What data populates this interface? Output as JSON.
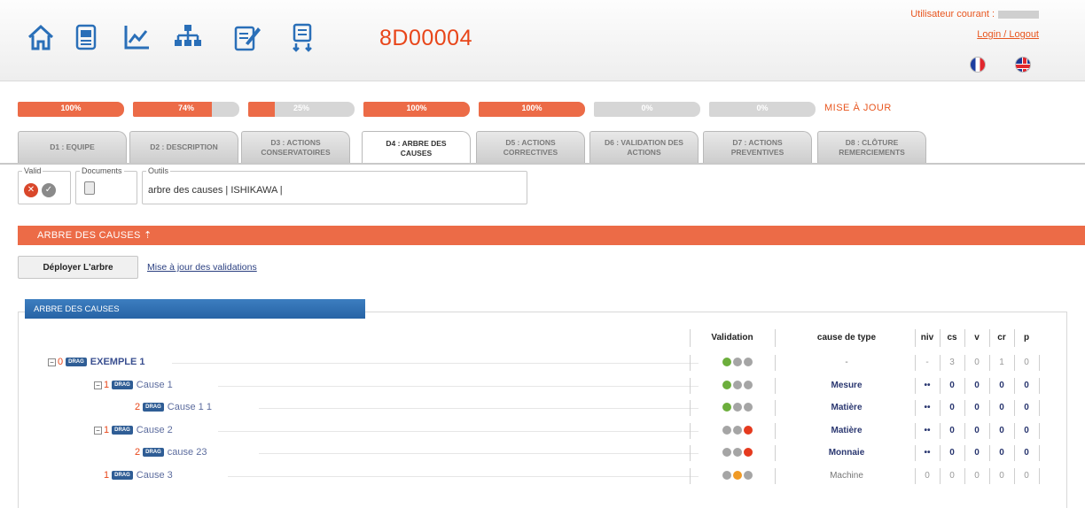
{
  "header": {
    "doc_id": "8D00004",
    "current_user_label": "Utilisateur courant :",
    "login_link": "Login / Logout",
    "nav_icons": [
      "home-icon",
      "report-icon",
      "chart-icon",
      "org-chart-icon",
      "edit-icon",
      "export-icon"
    ],
    "flags": [
      "french-flag-icon",
      "english-flag-icon"
    ]
  },
  "progress": {
    "bars": [
      {
        "label": "100%",
        "value": 100
      },
      {
        "label": "74%",
        "value": 74
      },
      {
        "label": "25%",
        "value": 25
      },
      {
        "label": "100%",
        "value": 100
      },
      {
        "label": "100%",
        "value": 100
      },
      {
        "label": "0%",
        "value": 0
      },
      {
        "label": "0%",
        "value": 0
      }
    ],
    "update_label": "MISE À JOUR"
  },
  "tabs": [
    {
      "line1": "D1 : EQUIPE",
      "line2": ""
    },
    {
      "line1": "D2 : DESCRIPTION",
      "line2": ""
    },
    {
      "line1": "D3 : ACTIONS",
      "line2": "CONSERVATOIRES"
    },
    {
      "line1": "D4 : ARBRE DES",
      "line2": "CAUSES",
      "active": true
    },
    {
      "line1": "D5 : ACTIONS",
      "line2": "CORRECTIVES"
    },
    {
      "line1": "D6 : VALIDATION DES",
      "line2": "ACTIONS"
    },
    {
      "line1": "D7 : ACTIONS",
      "line2": "PREVENTIVES"
    },
    {
      "line1": "D8 : CLÔTURE",
      "line2": "REMERCIEMENTS"
    }
  ],
  "toolbar": {
    "valid_label": "Valid",
    "documents_label": "Documents",
    "outils_label": "Outils",
    "outils_text": "arbre des causes | ISHIKAWA |"
  },
  "section": {
    "title": "ARBRE DES CAUSES ⇡",
    "deploy_button": "Déployer L'arbre",
    "update_link": "Mise à jour des validations",
    "panel_title": "ARBRE DES CAUSES"
  },
  "columns": {
    "validation": "Validation",
    "cause_type": "cause de type",
    "niv": "niv",
    "cs": "cs",
    "v": "v",
    "cr": "cr",
    "p": "p"
  },
  "tree": [
    {
      "expander": "⊟",
      "level": "0",
      "label": "EXEMPLE 1",
      "bold": true,
      "dots": [
        "#6cae3c",
        "#a5a5a5",
        "#a5a5a5"
      ],
      "cause_type": "-",
      "type_bold": false,
      "niv": "-",
      "cs": "3",
      "v": "0",
      "cr": "1",
      "p": "0",
      "values_bold": false
    },
    {
      "expander": "⊟",
      "level": "1",
      "label": "Cause 1",
      "bold": false,
      "dots": [
        "#6cae3c",
        "#a5a5a5",
        "#a5a5a5"
      ],
      "cause_type": "Mesure",
      "type_bold": true,
      "niv": "••",
      "cs": "0",
      "v": "0",
      "cr": "0",
      "p": "0",
      "values_bold": true
    },
    {
      "expander": "",
      "level": "2",
      "label": "Cause 1 1",
      "bold": false,
      "dots": [
        "#6cae3c",
        "#a5a5a5",
        "#a5a5a5"
      ],
      "cause_type": "Matière",
      "type_bold": true,
      "niv": "••",
      "cs": "0",
      "v": "0",
      "cr": "0",
      "p": "0",
      "values_bold": true
    },
    {
      "expander": "⊟",
      "level": "1",
      "label": "Cause 2",
      "bold": false,
      "dots": [
        "#a5a5a5",
        "#a5a5a5",
        "#e53a1e"
      ],
      "cause_type": "Matière",
      "type_bold": true,
      "niv": "••",
      "cs": "0",
      "v": "0",
      "cr": "0",
      "p": "0",
      "values_bold": true
    },
    {
      "expander": "",
      "level": "2",
      "label": "cause 23",
      "bold": false,
      "dots": [
        "#a5a5a5",
        "#a5a5a5",
        "#e53a1e"
      ],
      "cause_type": "Monnaie",
      "type_bold": true,
      "niv": "••",
      "cs": "0",
      "v": "0",
      "cr": "0",
      "p": "0",
      "values_bold": true
    },
    {
      "expander": "",
      "level": "1",
      "label": "Cause 3",
      "bold": false,
      "dots": [
        "#a5a5a5",
        "#f09a25",
        "#a5a5a5"
      ],
      "cause_type": "Machine",
      "type_bold": false,
      "niv": "0",
      "cs": "0",
      "v": "0",
      "cr": "0",
      "p": "0",
      "values_bold": false
    }
  ]
}
